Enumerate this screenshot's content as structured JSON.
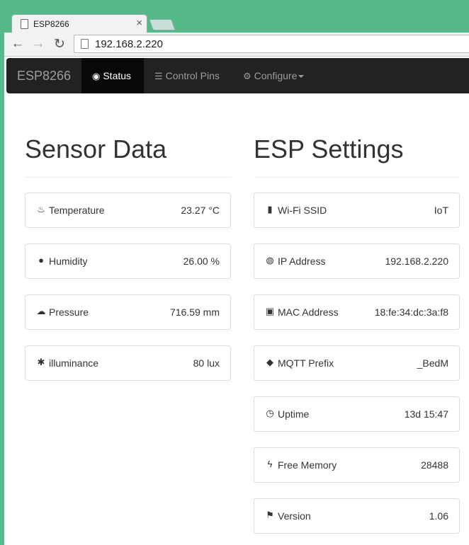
{
  "browser": {
    "tab_title": "ESP8266",
    "tab_close": "×",
    "url": "192.168.2.220",
    "back": "←",
    "forward": "→",
    "reload": "↻"
  },
  "navbar": {
    "brand": "ESP8266",
    "items": [
      {
        "label": "Status",
        "icon": "dashboard-icon",
        "glyph": "◉",
        "active": true
      },
      {
        "label": "Control Pins",
        "icon": "tasks-icon",
        "glyph": "☰",
        "active": false
      },
      {
        "label": "Configure",
        "icon": "cog-icon",
        "glyph": "⚙",
        "active": false
      }
    ]
  },
  "sensor": {
    "title": "Sensor Data",
    "items": [
      {
        "label": "Temperature",
        "value": "23.27 °C",
        "icon": "fire-icon",
        "glyph": "♨"
      },
      {
        "label": "Humidity",
        "value": "26.00 %",
        "icon": "tint-icon",
        "glyph": "●"
      },
      {
        "label": "Pressure",
        "value": "716.59 mm",
        "icon": "cloud-icon",
        "glyph": "☁"
      },
      {
        "label": "illuminance",
        "value": "80 lux",
        "icon": "asterisk-icon",
        "glyph": "✱"
      }
    ]
  },
  "esp": {
    "title": "ESP Settings",
    "items": [
      {
        "label": "Wi-Fi SSID",
        "value": "IoT",
        "icon": "signal-icon",
        "glyph": "▮"
      },
      {
        "label": "IP Address",
        "value": "192.168.2.220",
        "icon": "globe-icon",
        "glyph": "◍"
      },
      {
        "label": "MAC Address",
        "value": "18:fe:34:dc:3a:f8",
        "icon": "hdd-icon",
        "glyph": "▣"
      },
      {
        "label": "MQTT Prefix",
        "value": "_BedM",
        "icon": "tag-icon",
        "glyph": "◆"
      },
      {
        "label": "Uptime",
        "value": "13d 15:47",
        "icon": "time-icon",
        "glyph": "◷"
      },
      {
        "label": "Free Memory",
        "value": "28488",
        "icon": "flash-icon",
        "glyph": "ϟ"
      },
      {
        "label": "Version",
        "value": "1.06",
        "icon": "flag-icon",
        "glyph": "⚑"
      }
    ]
  }
}
